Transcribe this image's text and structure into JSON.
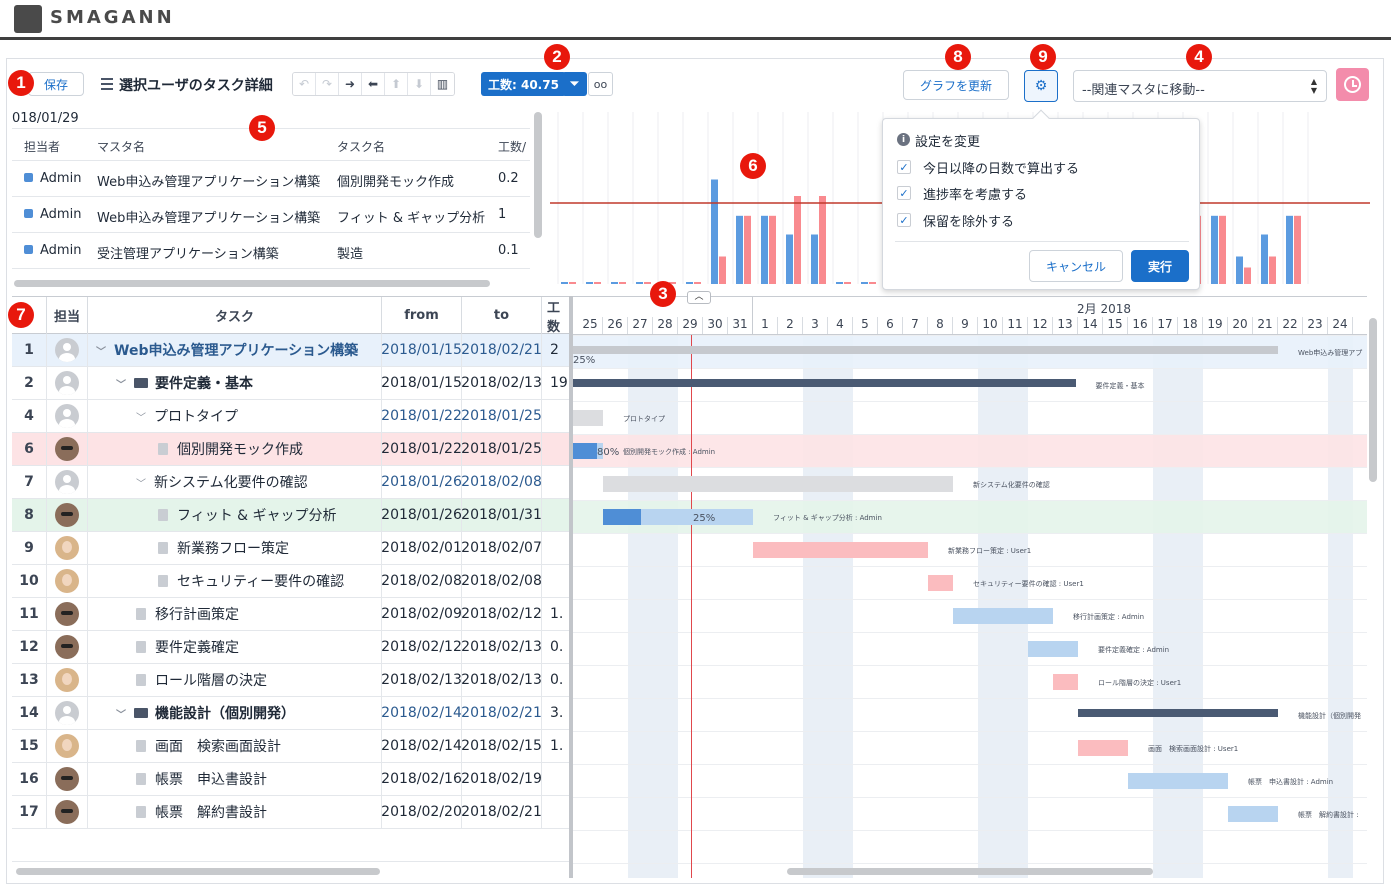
{
  "brand": {
    "name": "SMAGANN"
  },
  "toolbar": {
    "save_label": "保存",
    "title": "選択ユーザのタスク詳細",
    "effort_badge": "工数: 40.75",
    "refresh_graph_label": "グラフを更新",
    "related_master_select": "--関連マスタに移動--"
  },
  "callouts": [
    "1",
    "2",
    "3",
    "4",
    "5",
    "6",
    "7",
    "8",
    "9"
  ],
  "mini_table": {
    "date_label": "018/01/29",
    "headers": {
      "assignee": "担当者",
      "master": "マスタ名",
      "task": "タスク名",
      "effort": "工数/"
    },
    "rows": [
      {
        "assignee": "Admin",
        "master": "Web申込み管理アプリケーション構築",
        "task": "個別開発モック作成",
        "effort": "0.2"
      },
      {
        "assignee": "Admin",
        "master": "Web申込み管理アプリケーション構築",
        "task": "フィット & ギャップ分析",
        "effort": "1"
      },
      {
        "assignee": "Admin",
        "master": "受注管理アプリケーション構築",
        "task": "製造",
        "effort": "0.1"
      }
    ]
  },
  "chart_data": {
    "type": "bar",
    "title": "",
    "threshold_line": true,
    "series": [
      {
        "color": "#5b9be0",
        "values": [
          0,
          0,
          0,
          0,
          0,
          0,
          0.95,
          0.62,
          0.62,
          0.45,
          0.45,
          0,
          0,
          0.15,
          0.62,
          0,
          0,
          0,
          0,
          0,
          0,
          0,
          0,
          0,
          0,
          0.62,
          0.62,
          0.25,
          0.45,
          0.62
        ]
      },
      {
        "color": "#f98a8f",
        "values": [
          0,
          0,
          0,
          0,
          0,
          0,
          0.25,
          0.62,
          0.62,
          0.8,
          0.8,
          0,
          0,
          0.45,
          0.62,
          0,
          0,
          0,
          0,
          0,
          0,
          0,
          0,
          0,
          0,
          0.62,
          0.62,
          0.15,
          0.25,
          0.62
        ]
      }
    ]
  },
  "settings_popover": {
    "title": "設定を変更",
    "options": [
      "今日以降の日数で算出する",
      "進捗率を考慮する",
      "保留を除外する"
    ],
    "cancel_label": "キャンセル",
    "run_label": "実行"
  },
  "grid": {
    "headers": {
      "assignee": "担当",
      "task": "タスク",
      "from": "from",
      "to": "to",
      "effort": "工数"
    },
    "rows": [
      {
        "no": "1",
        "avatar": "gray",
        "indent": 0,
        "kind": "project",
        "task": "Web申込み管理アプリケーション構築",
        "from": "2018/01/15",
        "to": "2018/02/21",
        "effort": "2",
        "highlight": "selected"
      },
      {
        "no": "2",
        "avatar": "gray",
        "indent": 1,
        "kind": "folder",
        "task": "要件定義・基本",
        "from": "2018/01/15",
        "to": "2018/02/13",
        "effort": "19.",
        "highlight": ""
      },
      {
        "no": "4",
        "avatar": "gray",
        "indent": 2,
        "kind": "group",
        "task": "プロトタイプ",
        "from": "2018/01/22",
        "to": "2018/01/25",
        "effort": "",
        "highlight": ""
      },
      {
        "no": "6",
        "avatar": "man",
        "indent": 3,
        "kind": "file",
        "task": "個別開発モック作成",
        "from": "2018/01/22",
        "to": "2018/01/25",
        "effort": "",
        "highlight": "red"
      },
      {
        "no": "7",
        "avatar": "gray",
        "indent": 2,
        "kind": "group",
        "task": "新システム化要件の確認",
        "from": "2018/01/26",
        "to": "2018/02/08",
        "effort": "",
        "highlight": ""
      },
      {
        "no": "8",
        "avatar": "man",
        "indent": 3,
        "kind": "file",
        "task": "フィット & ギャップ分析",
        "from": "2018/01/26",
        "to": "2018/01/31",
        "effort": "",
        "highlight": "green"
      },
      {
        "no": "9",
        "avatar": "woman",
        "indent": 3,
        "kind": "file",
        "task": "新業務フロー策定",
        "from": "2018/02/01",
        "to": "2018/02/07",
        "effort": "",
        "highlight": ""
      },
      {
        "no": "10",
        "avatar": "woman",
        "indent": 3,
        "kind": "file",
        "task": "セキュリティー要件の確認",
        "from": "2018/02/08",
        "to": "2018/02/08",
        "effort": "",
        "highlight": ""
      },
      {
        "no": "11",
        "avatar": "man",
        "indent": 2,
        "kind": "file",
        "task": "移行計画策定",
        "from": "2018/02/09",
        "to": "2018/02/12",
        "effort": "1.",
        "highlight": ""
      },
      {
        "no": "12",
        "avatar": "man",
        "indent": 2,
        "kind": "file",
        "task": "要件定義確定",
        "from": "2018/02/12",
        "to": "2018/02/13",
        "effort": "0.",
        "highlight": ""
      },
      {
        "no": "13",
        "avatar": "woman",
        "indent": 2,
        "kind": "file",
        "task": "ロール階層の決定",
        "from": "2018/02/13",
        "to": "2018/02/13",
        "effort": "0.",
        "highlight": ""
      },
      {
        "no": "14",
        "avatar": "gray",
        "indent": 1,
        "kind": "folder",
        "task": "機能設計（個別開発）",
        "from": "2018/02/14",
        "to": "2018/02/21",
        "effort": "3.",
        "highlight": ""
      },
      {
        "no": "15",
        "avatar": "woman",
        "indent": 2,
        "kind": "file",
        "task": "画面　検索画面設計",
        "from": "2018/02/14",
        "to": "2018/02/15",
        "effort": "1.",
        "highlight": ""
      },
      {
        "no": "16",
        "avatar": "man",
        "indent": 2,
        "kind": "file",
        "task": "帳票　申込書設計",
        "from": "2018/02/16",
        "to": "2018/02/19",
        "effort": "",
        "highlight": ""
      },
      {
        "no": "17",
        "avatar": "man",
        "indent": 2,
        "kind": "file",
        "task": "帳票　解約書設計",
        "from": "2018/02/20",
        "to": "2018/02/21",
        "effort": "",
        "highlight": ""
      }
    ]
  },
  "gantt": {
    "month_label": "2月 2018",
    "days": [
      "25",
      "26",
      "27",
      "28",
      "29",
      "30",
      "31",
      "1",
      "2",
      "3",
      "4",
      "5",
      "6",
      "7",
      "8",
      "9",
      "10",
      "11",
      "12",
      "13",
      "14",
      "15",
      "16",
      "17",
      "18",
      "19",
      "20",
      "21",
      "22",
      "23",
      "24"
    ],
    "bars": [
      {
        "row": 0,
        "start": 0,
        "len": 28.2,
        "color": "#c6c9ce",
        "label": "Web申込み管理アプ",
        "pct": "25%"
      },
      {
        "row": 1,
        "start": 0,
        "len": 20.1,
        "color": "#4a5a73",
        "label": "要件定義・基本",
        "pct": ""
      },
      {
        "row": 2,
        "start": 0,
        "len": 1.2,
        "color": "#dcdde0",
        "label": "プロトタイプ",
        "pct": ""
      },
      {
        "row": 3,
        "start": 0,
        "len": 1.2,
        "color": "#b8d4f0",
        "label": "個別開発モック作成 : Admin",
        "pct": "80%"
      },
      {
        "row": 4,
        "start": 1.2,
        "len": 14,
        "color": "#dcdde0",
        "label": "新システム化要件の確認",
        "pct": ""
      },
      {
        "row": 5,
        "start": 1.2,
        "len": 6,
        "color": "#b8d4f0",
        "label": "フィット & ギャップ分析 : Admin",
        "pct": "25%"
      },
      {
        "row": 6,
        "start": 7.2,
        "len": 7,
        "color": "#fbbcbf",
        "label": "新業務フロー策定 : User1",
        "pct": ""
      },
      {
        "row": 7,
        "start": 14.2,
        "len": 1,
        "color": "#fbbcbf",
        "label": "セキュリティー要件の確認 : User1",
        "pct": ""
      },
      {
        "row": 8,
        "start": 15.2,
        "len": 4,
        "color": "#b8d4f0",
        "label": "移行計画策定 : Admin",
        "pct": ""
      },
      {
        "row": 9,
        "start": 18.2,
        "len": 2,
        "color": "#b8d4f0",
        "label": "要件定義確定 : Admin",
        "pct": ""
      },
      {
        "row": 10,
        "start": 19.2,
        "len": 1,
        "color": "#fbbcbf",
        "label": "ロール階層の決定 : User1",
        "pct": ""
      },
      {
        "row": 11,
        "start": 20.2,
        "len": 8,
        "color": "#4a5a73",
        "label": "機能設計（個別開発",
        "pct": ""
      },
      {
        "row": 12,
        "start": 20.2,
        "len": 2,
        "color": "#fbbcbf",
        "label": "画面　検索画面設計 : User1",
        "pct": ""
      },
      {
        "row": 13,
        "start": 22.2,
        "len": 4,
        "color": "#b8d4f0",
        "label": "帳票　申込書設計 : Admin",
        "pct": ""
      },
      {
        "row": 14,
        "start": 26.2,
        "len": 2,
        "color": "#b8d4f0",
        "label": "帳票　解約書設計 :",
        "pct": ""
      }
    ]
  }
}
